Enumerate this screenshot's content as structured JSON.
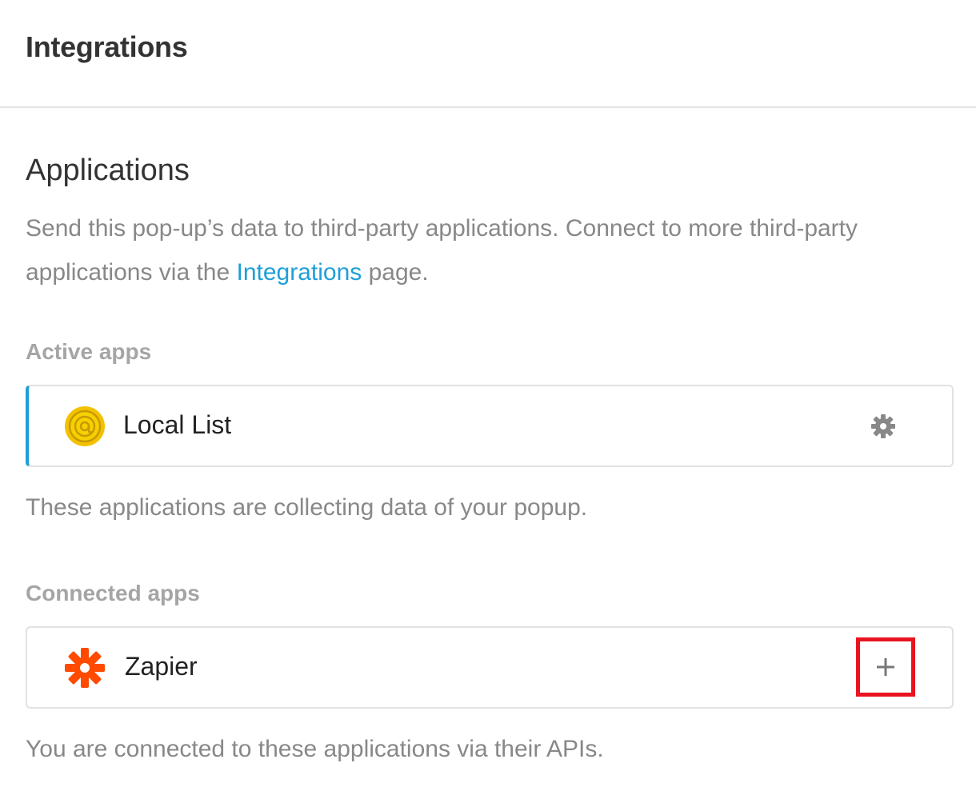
{
  "header": {
    "title": "Integrations"
  },
  "applications": {
    "title": "Applications",
    "description_before": "Send this pop-up’s data to third-party applications. Connect to more third-party applications via the ",
    "description_link": "Integrations",
    "description_after": " page."
  },
  "active_apps": {
    "label": "Active apps",
    "items": [
      {
        "name": "Local List",
        "icon": "local-list-logo-icon",
        "action_icon": "gear-icon"
      }
    ],
    "note": "These applications are collecting data of your popup."
  },
  "connected_apps": {
    "label": "Connected apps",
    "items": [
      {
        "name": "Zapier",
        "icon": "zapier-logo-icon",
        "action_icon": "plus-icon"
      }
    ],
    "note": "You are connected to these applications via their APIs."
  },
  "colors": {
    "accent": "#1e9fd8",
    "zapier": "#ff4a00",
    "local_list": "#f2c200",
    "highlight": "#e8141f"
  }
}
